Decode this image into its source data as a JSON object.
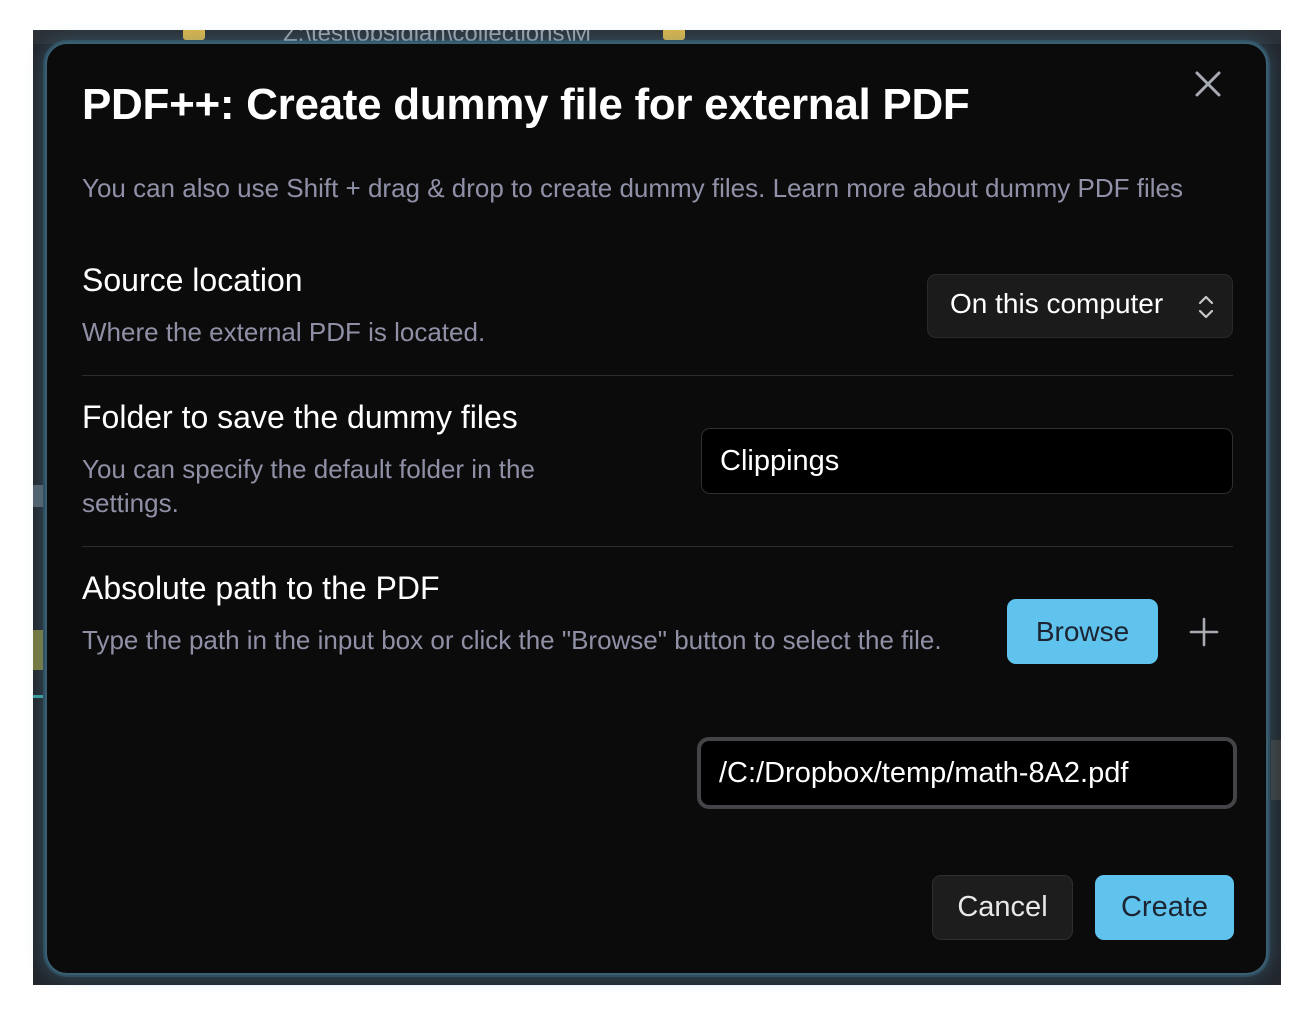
{
  "background": {
    "path_text": "Z:\\test\\obsidian\\collections\\M"
  },
  "modal": {
    "title": "PDF++: Create dummy file for external PDF",
    "description": "You can also use Shift + drag & drop to create dummy files. Learn more about dummy PDF files",
    "close_icon": "close-icon"
  },
  "settings": {
    "source_location": {
      "name": "Source location",
      "description": "Where the external PDF is located.",
      "selected_option": "On this computer",
      "icon": "chevron-up-down-icon"
    },
    "folder": {
      "name": "Folder to save the dummy files",
      "description": "You can specify the default folder in the settings.",
      "value": "Clippings"
    },
    "absolute_path": {
      "name": "Absolute path to the PDF",
      "description": "Type the path in the input box or click the \"Browse\" button to select the file.",
      "browse_label": "Browse",
      "add_icon": "plus-icon",
      "value": "/C:/Dropbox/temp/math-8A2.pdf"
    }
  },
  "buttons": {
    "cancel_label": "Cancel",
    "create_label": "Create"
  },
  "colors": {
    "accent": "#5fc3ee",
    "modal_bg": "#0b0b0b",
    "muted_text": "#8f90a6"
  }
}
